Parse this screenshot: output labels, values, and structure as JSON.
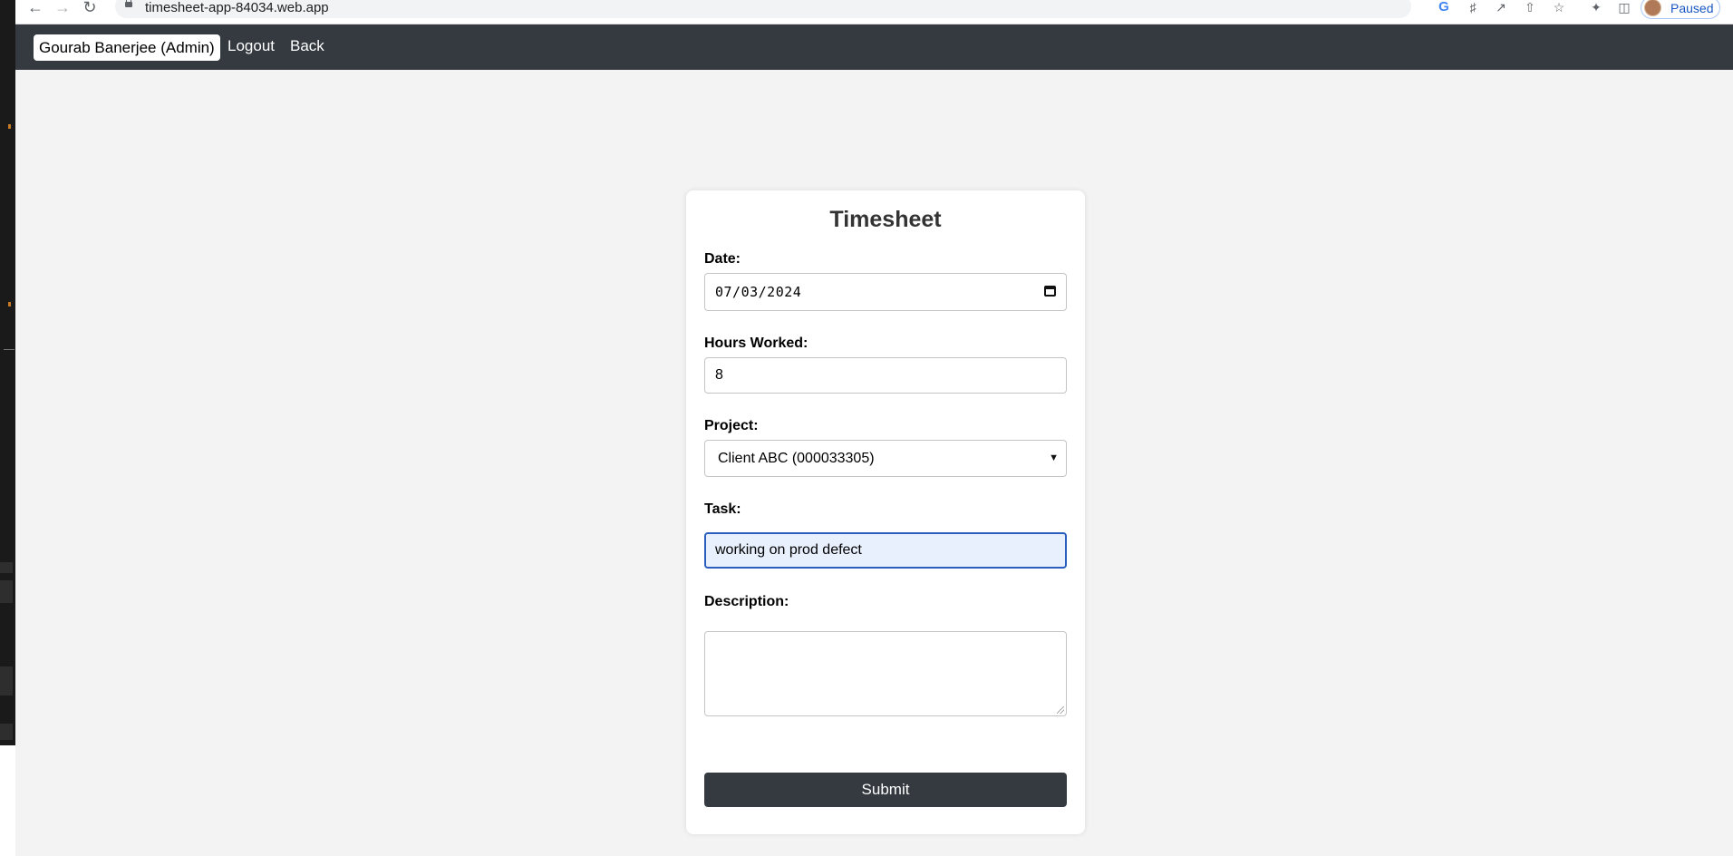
{
  "browser": {
    "url": "timesheet-app-84034.web.app",
    "profile_status": "Paused",
    "icons": [
      "back-arrow-icon",
      "forward-arrow-icon",
      "reload-icon",
      "lock-icon",
      "google-icon",
      "key-icon",
      "open-in-new-icon",
      "share-icon",
      "star-icon",
      "puzzle-icon",
      "sidebar-icon",
      "avatar-icon"
    ]
  },
  "appbar": {
    "user": "Gourab Banerjee (Admin)",
    "logout_label": "Logout",
    "back_label": "Back",
    "background": "#343a40"
  },
  "form": {
    "title": "Timesheet",
    "date_label": "Date:",
    "date_value": "07/03/2024",
    "hours_label": "Hours Worked:",
    "hours_value": "8",
    "project_label": "Project:",
    "project_value": "Client ABC (000033305)",
    "task_label": "Task:",
    "task_value": "working on prod defect",
    "description_label": "Description:",
    "description_value": "",
    "submit_label": "Submit",
    "focus_color": "#2a5dbd"
  }
}
